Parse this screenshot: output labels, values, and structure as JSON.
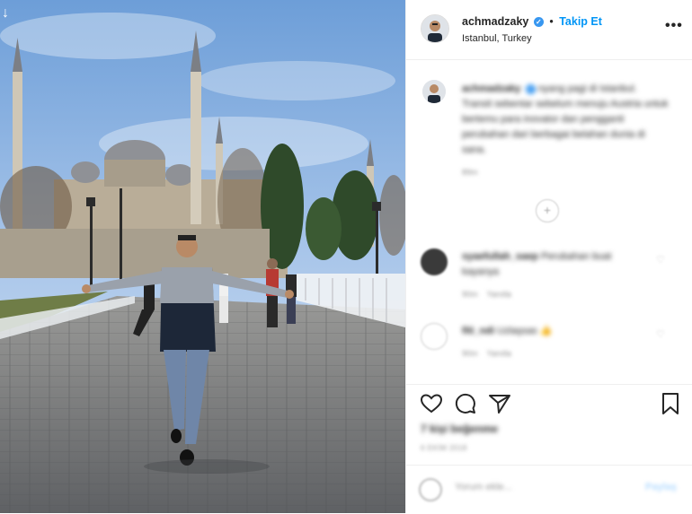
{
  "photo": {
    "download_icon": "down-arrow-icon"
  },
  "header": {
    "username": "achmadzaky",
    "verified_glyph": "✓",
    "separator": "•",
    "follow_label": "Takip Et",
    "location": "Istanbul, Turkey",
    "more_glyph": "•••"
  },
  "caption": {
    "username": "achmadzaky",
    "text": "nyang pagi di Istanbul. Transit sebentar sebelum menuju Austria untuk bertemu para inovator dan pengganti perubahan dari berbagai belahan dunia di sana.",
    "time": "89m"
  },
  "load_more_glyph": "+",
  "comments": [
    {
      "username": "syaefullah_saep",
      "text": "Perubahan buat kayanya",
      "time": "90m",
      "reply": "Yanıtla"
    },
    {
      "username": "fiti_ndi",
      "text": "Uzlaşsas 👍",
      "time": "90m",
      "reply": "Yanıtla"
    }
  ],
  "likes": "7 kişi beğenme",
  "date": "6 EKİM 2018",
  "comment_bar": {
    "placeholder": "Yorum ekle...",
    "post_label": "Paylaş"
  },
  "colors": {
    "accent": "#0095f6",
    "verified": "#3897f0",
    "text": "#262626",
    "muted": "#8e8e8e"
  }
}
